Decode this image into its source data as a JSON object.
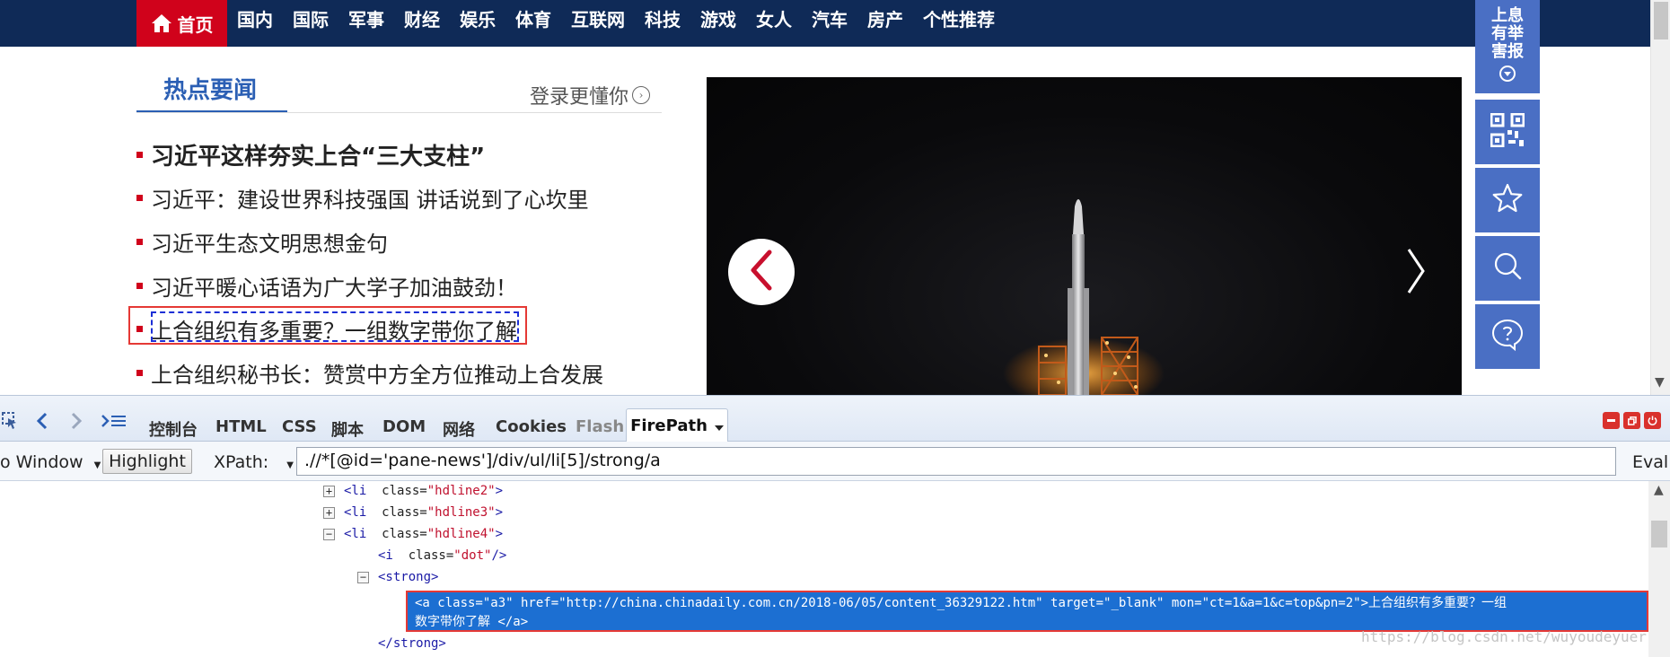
{
  "topnav": {
    "home": "首页",
    "items": [
      "国内",
      "国际",
      "军事",
      "财经",
      "娱乐",
      "体育",
      "互联网",
      "科技",
      "游戏",
      "女人",
      "汽车",
      "房产",
      "个性推荐"
    ]
  },
  "rail": {
    "report_text": "上息有举害报",
    "icons": [
      "qr-code-icon",
      "star-icon",
      "search-icon",
      "chat-icon"
    ]
  },
  "headlines": {
    "title": "热点要闻",
    "login_text": "登录更懂你",
    "items": [
      "习近平这样夯实上合“三大支柱”",
      "习近平：建设世界科技强国 讲话说到了心坎里",
      "习近平生态文明思想金句",
      "习近平暖心话语为广大学子加油鼓劲！",
      "上合组织有多重要？一组数字带你了解",
      "上合组织秘书长：赞赏中方全方位推动上合发展"
    ]
  },
  "devtools": {
    "tabs": [
      "控制台",
      "HTML",
      "CSS",
      "脚本",
      "DOM",
      "网络",
      "Cookies",
      "Flash"
    ],
    "active_tab": "FirePath",
    "toolbar": {
      "window_label": "o Window",
      "highlight_label": "Highlight",
      "xpath_label": "XPath:",
      "xpath_value": ".//*[@id='pane-news']/div/ul/li[5]/strong/a",
      "eval_label": "Eval"
    },
    "tree": {
      "row1_tag": "<li",
      "row1_attr": "class=",
      "row1_val": "\"hdline2\"",
      "row2_tag": "<li",
      "row2_attr": "class=",
      "row2_val": "\"hdline3\"",
      "row3_tag": "<li",
      "row3_attr": "class=",
      "row3_val": "\"hdline4\"",
      "row4_tag": "<i",
      "row4_attr": "class=",
      "row4_val": "\"dot\"",
      "row5_tag": "<strong>",
      "selected_line1": "<a  class=\"a3\"  href=\"http://china.chinadaily.com.cn/2018-06/05/content_36329122.htm\"  target=\"_blank\"  mon=\"ct=1&a=1&c=top&pn=2\">上合组织有多重要？一组",
      "selected_line2": "数字带你了解  </a>",
      "row7": "</strong>"
    }
  },
  "watermark": "https://blog.csdn.net/wuyoudeyuer",
  "colors": {
    "nav_bg": "#0f2a57",
    "home_red": "#d0021b",
    "rail_blue": "#4a6fc4",
    "title_blue": "#2b5fb4",
    "selection_blue": "#1c6fd2"
  }
}
